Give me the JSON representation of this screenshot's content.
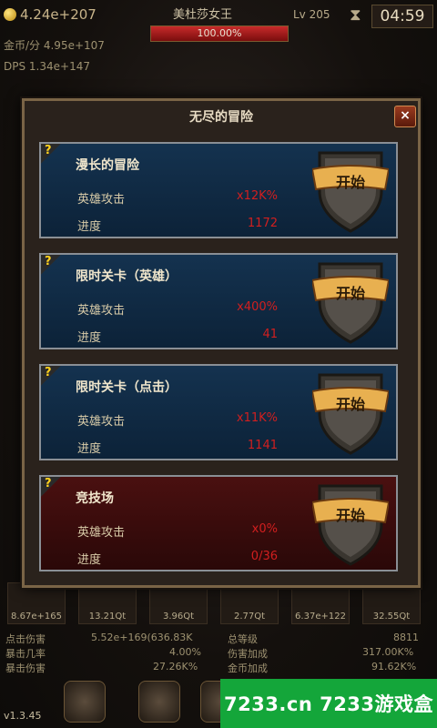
{
  "hud": {
    "gold_total": "4.24e+207",
    "boss_name": "美杜莎女王",
    "boss_hp_percent": "100.00%",
    "boss_hp_fraction": 1.0,
    "level": "Lv 205",
    "timer": "04:59",
    "gold_rate": "金币/分 4.95e+107",
    "dps": "DPS    1.34e+147"
  },
  "hero_slots": [
    "8.67e+165",
    "13.21Qt",
    "3.96Qt",
    "2.77Qt",
    "6.37e+122",
    "32.55Qt"
  ],
  "stats": {
    "click_damage_label": "点击伤害",
    "click_damage_value": "5.52e+169(636.83K",
    "crit_chance_label": "暴击几率",
    "crit_chance_value": "4.00%",
    "crit_damage_label": "暴击伤害",
    "crit_damage_value": "27.26K%",
    "total_level_label": "总等级",
    "total_level_value": "8811",
    "damage_bonus_label": "伤害加成",
    "damage_bonus_value": "317.00K%",
    "gold_bonus_label": "金币加成",
    "gold_bonus_value": "91.62K%"
  },
  "version": "v1.3.45",
  "modal": {
    "title": "无尽的冒险",
    "close_label": "×",
    "cards": [
      {
        "name": "漫长的冒险",
        "attack_label": "英雄攻击",
        "attack_value": "x12K%",
        "progress_label": "进度",
        "progress_value": "1172",
        "button": "开始",
        "style": "blue"
      },
      {
        "name": "限时关卡（英雄）",
        "attack_label": "英雄攻击",
        "attack_value": "x400%",
        "progress_label": "进度",
        "progress_value": "41",
        "button": "开始",
        "style": "blue"
      },
      {
        "name": "限时关卡（点击）",
        "attack_label": "英雄攻击",
        "attack_value": "x11K%",
        "progress_label": "进度",
        "progress_value": "1141",
        "button": "开始",
        "style": "blue"
      },
      {
        "name": "竞技场",
        "attack_label": "英雄攻击",
        "attack_value": "x0%",
        "progress_label": "进度",
        "progress_value": "0/36",
        "button": "开始",
        "style": "red"
      }
    ]
  },
  "watermark": "7233.cn 7233游戏盒"
}
